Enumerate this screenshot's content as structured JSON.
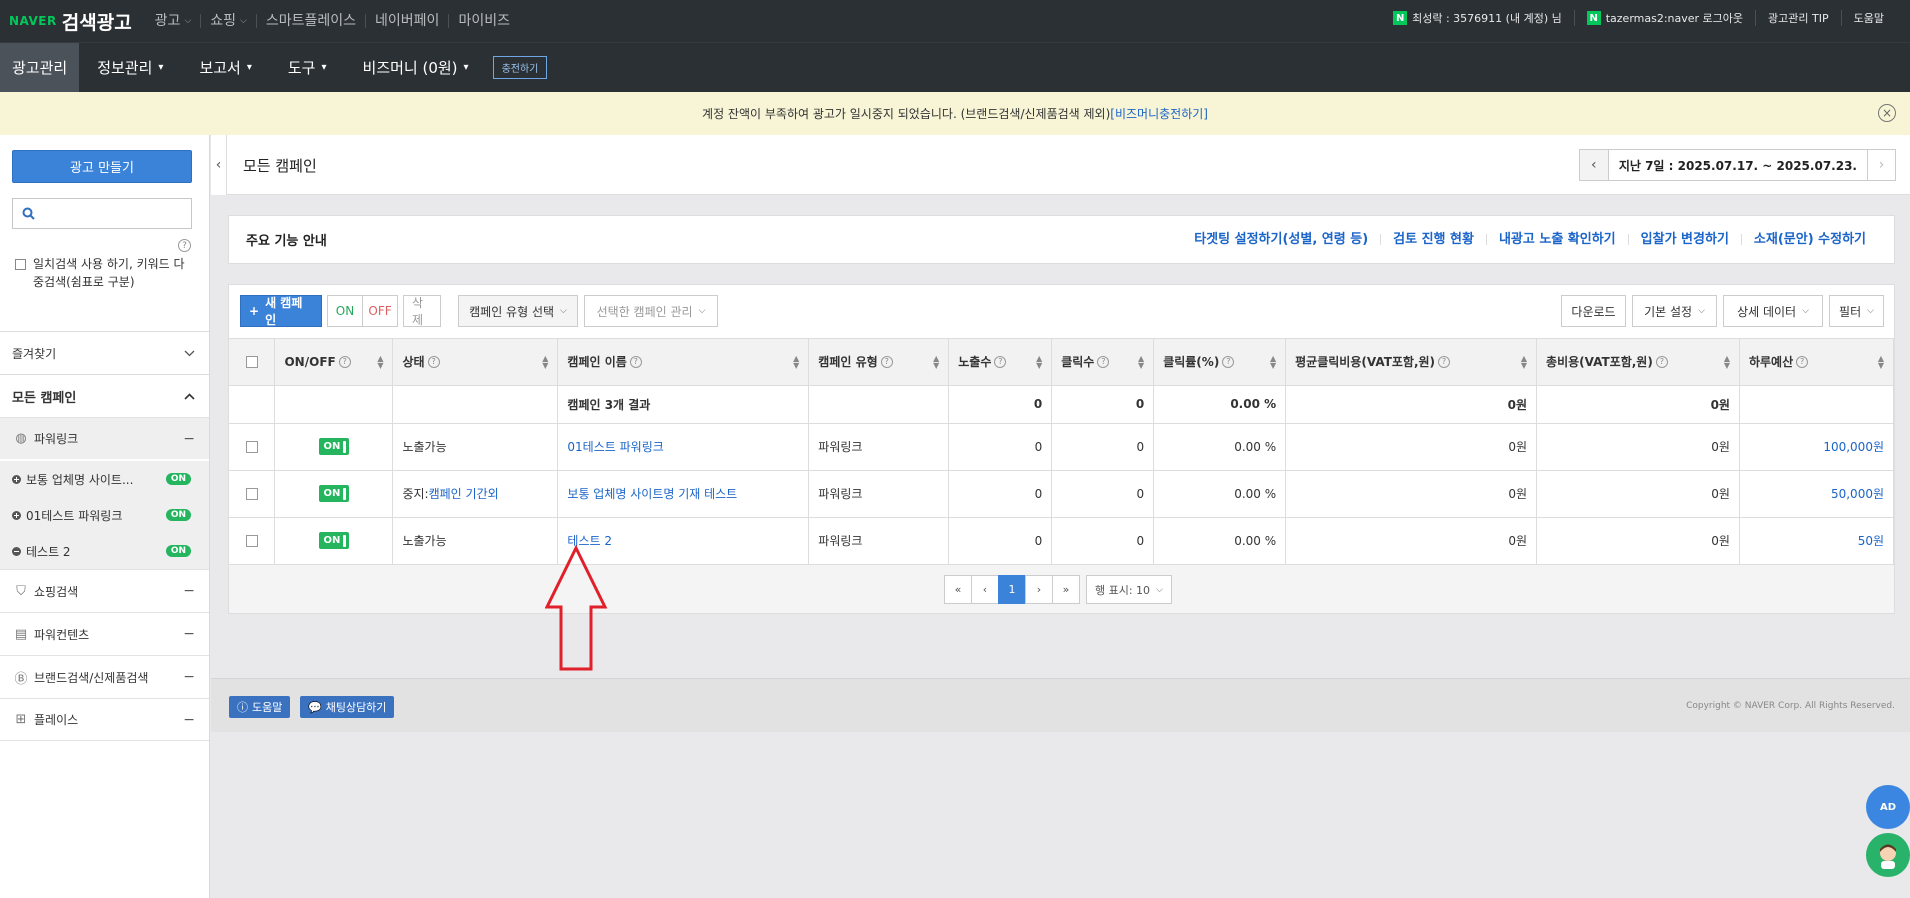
{
  "topbar": {
    "naver": "NAVER",
    "brand": "검색광고",
    "nav": [
      "광고",
      "쇼핑",
      "스마트플레이스",
      "네이버페이",
      "마이비즈"
    ],
    "account": "최성락 : 3576911 (내 계정) 님",
    "user": "tazermas2:naver 로그아웃",
    "tip": "광고관리 TIP",
    "help": "도움말"
  },
  "mainnav": {
    "items": [
      "광고관리",
      "정보관리",
      "보고서",
      "도구",
      "비즈머니 (0원)"
    ],
    "charge": "충전하기"
  },
  "notice": {
    "text": "계정 잔액이 부족하여 광고가 일시중지 되었습니다. (브랜드검색/신제품검색 제외)",
    "link": "[비즈머니충전하기]"
  },
  "sidebar": {
    "create": "광고 만들기",
    "exact_search": "일치검색 사용 하기, 키워드 다중검색(쉼표로 구분)",
    "favorites": "즐겨찾기",
    "all_campaigns": "모든 캠페인",
    "groups": [
      "파워링크",
      "쇼핑검색",
      "파워컨텐츠",
      "브랜드검색/신제품검색",
      "플레이스"
    ],
    "campaigns": [
      {
        "name": "보통 업체명 사이트...",
        "status": "ON"
      },
      {
        "name": "01테스트 파워링크",
        "status": "ON"
      },
      {
        "name": "테스트 2",
        "status": "ON"
      }
    ]
  },
  "content": {
    "title": "모든 캠페인",
    "date_range": "지난 7일 : 2025.07.17. ~ 2025.07.23.",
    "guide_title": "주요 기능 안내",
    "guide_links": [
      "타겟팅 설정하기(성별, 연령 등)",
      "검토 진행 현황",
      "내광고 노출 확인하기",
      "입찰가 변경하기",
      "소재(문안) 수정하기"
    ]
  },
  "toolbar": {
    "new_campaign": "새 캠페인",
    "on": "ON",
    "off": "OFF",
    "delete": "삭제",
    "type_select": "캠페인 유형 선택",
    "manage": "선택한 캠페인 관리",
    "download": "다운로드",
    "basic": "기본 설정",
    "detail": "상세 데이터",
    "filter": "필터"
  },
  "table": {
    "headers": [
      "ON/OFF",
      "상태",
      "캠페인 이름",
      "캠페인 유형",
      "노출수",
      "클릭수",
      "클릭률(%)",
      "평균클릭비용(VAT포함,원)",
      "총비용(VAT포함,원)",
      "하루예산"
    ],
    "summary": {
      "label": "캠페인 3개 결과",
      "impressions": "0",
      "clicks": "0",
      "ctr": "0.00 %",
      "cpc": "0원",
      "cost": "0원"
    },
    "rows": [
      {
        "onoff": "ON",
        "status_prefix": "",
        "status": "노출가능",
        "name": "01테스트 파워링크",
        "type": "파워링크",
        "impressions": "0",
        "clicks": "0",
        "ctr": "0.00 %",
        "cpc": "0원",
        "cost": "0원",
        "budget": "100,000원"
      },
      {
        "onoff": "ON",
        "status_prefix": "중지:",
        "status": "캠페인 기간외",
        "name": "보통 업체명 사이트명 기재 테스트",
        "type": "파워링크",
        "impressions": "0",
        "clicks": "0",
        "ctr": "0.00 %",
        "cpc": "0원",
        "cost": "0원",
        "budget": "50,000원"
      },
      {
        "onoff": "ON",
        "status_prefix": "",
        "status": "노출가능",
        "name": "테스트 2",
        "type": "파워링크",
        "impressions": "0",
        "clicks": "0",
        "ctr": "0.00 %",
        "cpc": "0원",
        "cost": "0원",
        "budget": "50원"
      }
    ]
  },
  "pager": {
    "current": "1",
    "rows_label": "행 표시: 10"
  },
  "footer": {
    "help": "도움말",
    "chat": "채팅상담하기",
    "copyright": "Copyright © NAVER Corp. All Rights Reserved."
  },
  "float": {
    "ad": "AD"
  }
}
